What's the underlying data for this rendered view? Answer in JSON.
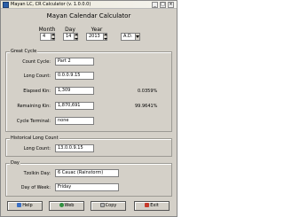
{
  "window": {
    "title": "Mayan LC, CR Calculator (v. 1.0.0.0)",
    "minimize_glyph": "_",
    "maximize_glyph": "□",
    "close_glyph": "×"
  },
  "heading": "Mayan Calendar Calculator",
  "date": {
    "month_label": "Month",
    "day_label": "Day",
    "year_label": "Year",
    "month_value": "4",
    "day_value": "14",
    "year_value": "2013",
    "era_value": "A.D."
  },
  "great_cycle": {
    "title": "Great Cycle",
    "count_label": "Count Cycle:",
    "count_value": "Part 2",
    "long_count_label": "Long Count:",
    "long_count_value": "0.0.0.9.15",
    "elapsed_label": "Elapsed Kin:",
    "elapsed_value": "1,309",
    "elapsed_percent": "0.0359%",
    "remaining_label": "Remaining Kin:",
    "remaining_value": "1,870,691",
    "remaining_percent": "99.9641%",
    "cycle_terminal_label": "Cycle Terminal:",
    "cycle_terminal_value": "none"
  },
  "historical": {
    "title": "Historical Long Count",
    "long_count_label": "Long Count:",
    "long_count_value": "13.0.0.9.15"
  },
  "day": {
    "title": "Day",
    "tzolkin_label": "Tzolkin Day:",
    "tzolkin_value": "6 Cauac (Rainstorm)",
    "weekday_label": "Day of Week:",
    "weekday_value": "Friday"
  },
  "buttons": {
    "help": "Help",
    "web": "Web",
    "copy": "Copy",
    "exit": "Exit"
  },
  "colors": {
    "face": "#d4d0c8",
    "field_bg": "#ffffff",
    "help_icon": "#3a6fc4",
    "web_icon": "#2f8f3f",
    "copy_icon": "#b5b5b5",
    "exit_icon": "#c63a2b"
  },
  "icons": {
    "app": "calendar-app-icon",
    "help": "help-icon",
    "web": "web-icon",
    "copy": "copy-icon",
    "exit": "exit-icon"
  }
}
